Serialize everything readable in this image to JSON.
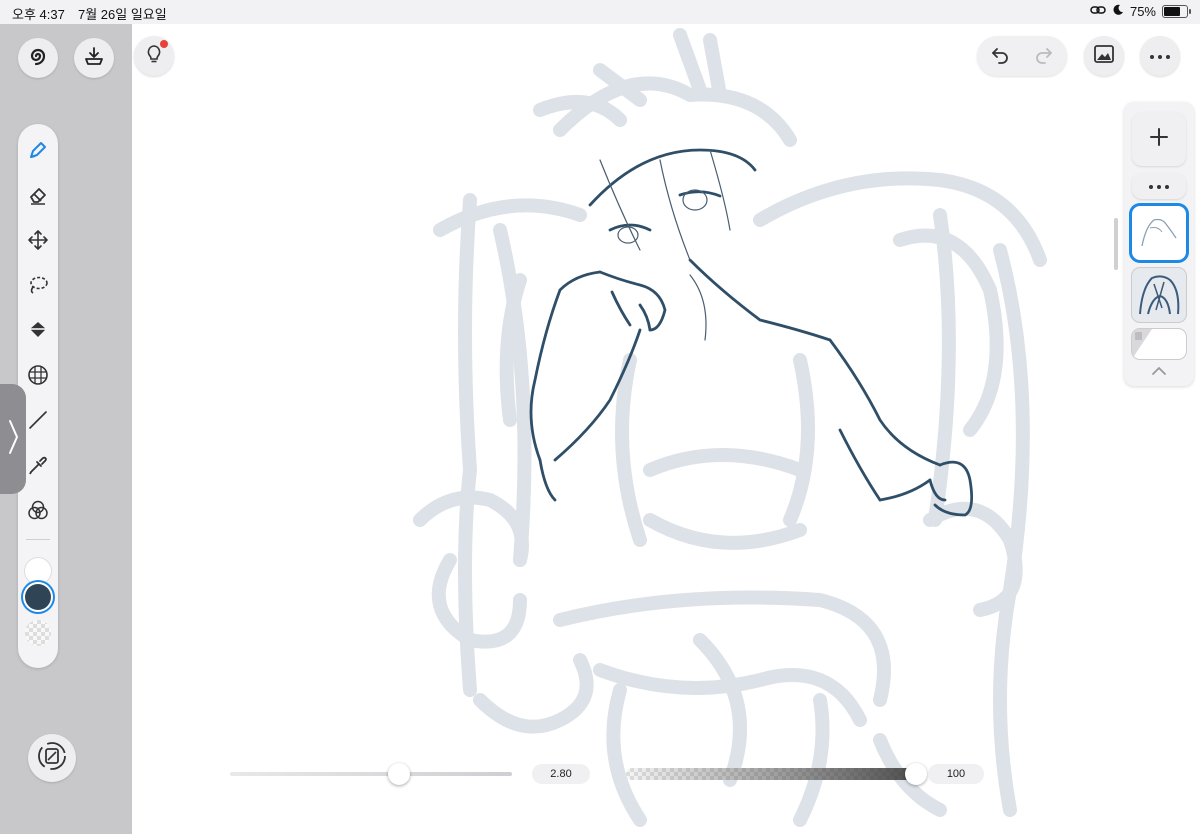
{
  "status_bar": {
    "time": "오후 4:37",
    "date": "7월 26일 일요일",
    "battery_percent": "75%",
    "battery_level": 0.75,
    "icons": [
      "link-icon",
      "moon-icon",
      "battery-icon"
    ]
  },
  "left_controls": {
    "app_icon": "spiral-logo-icon",
    "import_icon": "tray-download-icon",
    "tip_icon": "lightbulb-icon",
    "tip_badge_color": "#e8403a"
  },
  "tools": [
    {
      "name": "pen-tool",
      "icon": "pen-icon",
      "active": true
    },
    {
      "name": "eraser-tool",
      "icon": "eraser-icon",
      "active": false
    },
    {
      "name": "move-tool",
      "icon": "move-arrows-icon",
      "active": false
    },
    {
      "name": "lasso-tool",
      "icon": "lasso-icon",
      "active": false
    },
    {
      "name": "fill-tool",
      "icon": "paint-bucket-icon",
      "active": false
    },
    {
      "name": "grid-tool",
      "icon": "perspective-grid-icon",
      "active": false
    },
    {
      "name": "line-tool",
      "icon": "line-icon",
      "active": false
    },
    {
      "name": "eyedropper-tool",
      "icon": "eyedropper-icon",
      "active": false
    },
    {
      "name": "color-mix-tool",
      "icon": "color-circles-icon",
      "active": false
    }
  ],
  "colors": {
    "accent": "#1e88e5",
    "primary_swatch": "#ffffff",
    "secondary_swatch": "#2f4556",
    "stroke_color": "#2f4f69",
    "sketch_color": "#dde2e8"
  },
  "top_right": {
    "undo_icon": "undo-arrow-icon",
    "redo_icon": "redo-arrow-icon",
    "gallery_icon": "image-gallery-icon",
    "more_icon": "ellipsis-icon"
  },
  "layers": {
    "add_icon": "plus-icon",
    "more_icon": "ellipsis-icon",
    "collapse_icon": "chevron-up-icon",
    "items": [
      {
        "name": "line-layer",
        "selected": true
      },
      {
        "name": "sketch-layer",
        "selected": false
      },
      {
        "name": "background-layer",
        "selected": false
      }
    ]
  },
  "sliders": {
    "brush_size": {
      "value": "2.80",
      "fraction": 0.6
    },
    "opacity": {
      "value": "100",
      "fraction": 1.0
    }
  },
  "bottom_left_icon": "rotate-canvas-icon"
}
